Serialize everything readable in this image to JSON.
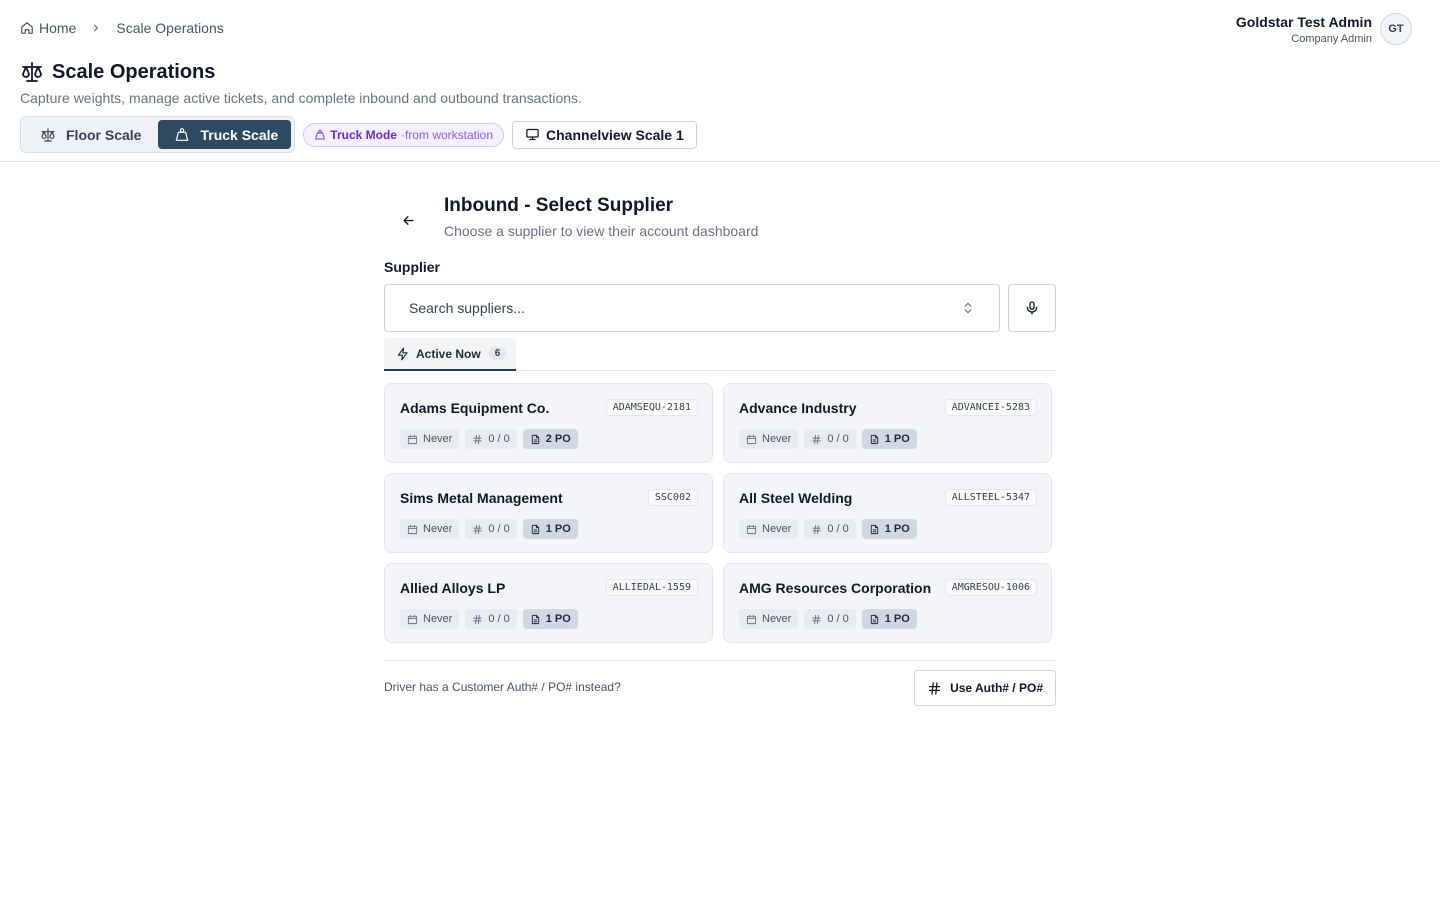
{
  "breadcrumb": {
    "home": "Home",
    "current": "Scale Operations"
  },
  "user": {
    "name": "Goldstar Test Admin",
    "role": "Company Admin",
    "initials": "GT"
  },
  "page": {
    "title": "Scale Operations",
    "subtitle": "Capture weights, manage active tickets, and complete inbound and outbound transactions."
  },
  "modes": {
    "floor": "Floor Scale",
    "truck": "Truck Scale",
    "active": "truck"
  },
  "truck_mode_pill": {
    "label": "Truck Mode",
    "suffix": "·from workstation"
  },
  "station": {
    "label": "Channelview Scale 1"
  },
  "panel": {
    "title": "Inbound - Select Supplier",
    "subtitle": "Choose a supplier to view their account dashboard",
    "field_label": "Supplier",
    "search_placeholder": "Search suppliers...",
    "tab": {
      "label": "Active Now",
      "count": "6"
    }
  },
  "suppliers": [
    {
      "name": "Adams Equipment Co.",
      "code": "ADAMSEQU-2181",
      "last": "Never",
      "counts": "0 / 0",
      "po": "2 PO"
    },
    {
      "name": "Advance Industry",
      "code": "ADVANCEI-5283",
      "last": "Never",
      "counts": "0 / 0",
      "po": "1 PO"
    },
    {
      "name": "Sims Metal Management",
      "code": "SSC002",
      "last": "Never",
      "counts": "0 / 0",
      "po": "1 PO"
    },
    {
      "name": "All Steel Welding",
      "code": "ALLSTEEL-5347",
      "last": "Never",
      "counts": "0 / 0",
      "po": "1 PO"
    },
    {
      "name": "Allied Alloys LP",
      "code": "ALLIEDAL-1559",
      "last": "Never",
      "counts": "0 / 0",
      "po": "1 PO"
    },
    {
      "name": "AMG Resources Corporation",
      "code": "AMGRESOU-1006",
      "last": "Never",
      "counts": "0 / 0",
      "po": "1 PO"
    }
  ],
  "footer": {
    "text": "Driver has a Customer Auth# / PO# instead?",
    "button": "Use Auth# / PO#"
  },
  "colors": {
    "accent": "#2d4a63",
    "pill_purple": "#7c3aed",
    "card_bg": "#f3f5f8"
  }
}
